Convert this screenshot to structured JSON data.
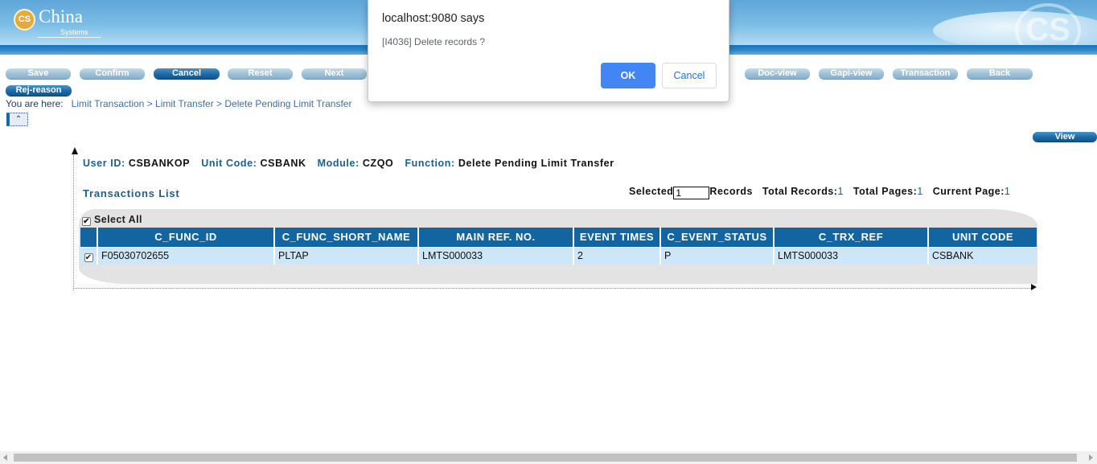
{
  "header": {
    "logo_mark": "CS",
    "brand": "China",
    "brand_sub": "Systems",
    "deco_mark": "CS"
  },
  "toolbar": {
    "buttons": [
      {
        "label": "Save",
        "state": "normal"
      },
      {
        "label": "Confirm",
        "state": "normal"
      },
      {
        "label": "Cancel",
        "state": "active"
      },
      {
        "label": "Reset",
        "state": "normal"
      },
      {
        "label": "Next",
        "state": "normal"
      },
      {
        "label": "Doc-view",
        "state": "normal"
      },
      {
        "label": "Gapi-view",
        "state": "normal"
      },
      {
        "label": "Transaction",
        "state": "normal"
      },
      {
        "label": "Back",
        "state": "normal"
      },
      {
        "label": "Rej-reason",
        "state": "active"
      }
    ]
  },
  "breadcrumb": {
    "label": "You are here:",
    "trail": "Limit Transaction > Limit Transfer > Delete Pending Limit Transfer"
  },
  "collapse_icon": "double-chevron-up",
  "view_button": "View",
  "info": {
    "user_id_label": "User ID:",
    "user_id": "CSBANKOP",
    "unit_code_label": "Unit Code:",
    "unit_code": "CSBANK",
    "module_label": "Module:",
    "module": "CZQO",
    "function_label": "Function:",
    "function": "Delete Pending Limit Transfer"
  },
  "transactions": {
    "title": "Transactions List",
    "selected_label": "Selected",
    "selected_value": "1",
    "records_label": "Records",
    "total_records_label": "Total Records:",
    "total_records": "1",
    "total_pages_label": "Total Pages:",
    "total_pages": "1",
    "current_page_label": "Current Page:",
    "current_page": "1",
    "select_all_label": "Select All",
    "select_all_checked": true,
    "columns": [
      "C_FUNC_ID",
      "C_FUNC_SHORT_NAME",
      "MAIN REF. NO.",
      "EVENT TIMES",
      "C_EVENT_STATUS",
      "C_TRX_REF",
      "UNIT CODE"
    ],
    "rows": [
      {
        "checked": true,
        "cells": [
          "F05030702655",
          "PLTAP",
          "LMTS000033",
          "2",
          "P",
          "LMTS000033",
          "CSBANK"
        ]
      }
    ]
  },
  "dialog": {
    "title": "localhost:9080 says",
    "message": "[I4036] Delete records ?",
    "ok_label": "OK",
    "cancel_label": "Cancel"
  },
  "colors": {
    "header_blue": "#1a74b8",
    "toolbar_button": "#9cbfd6",
    "toolbar_button_active": "#1d6aa6",
    "grid_header": "#1265a0",
    "grid_row": "#cde6f8",
    "label_blue": "#1c5e8c",
    "dialog_ok": "#4285f4"
  }
}
